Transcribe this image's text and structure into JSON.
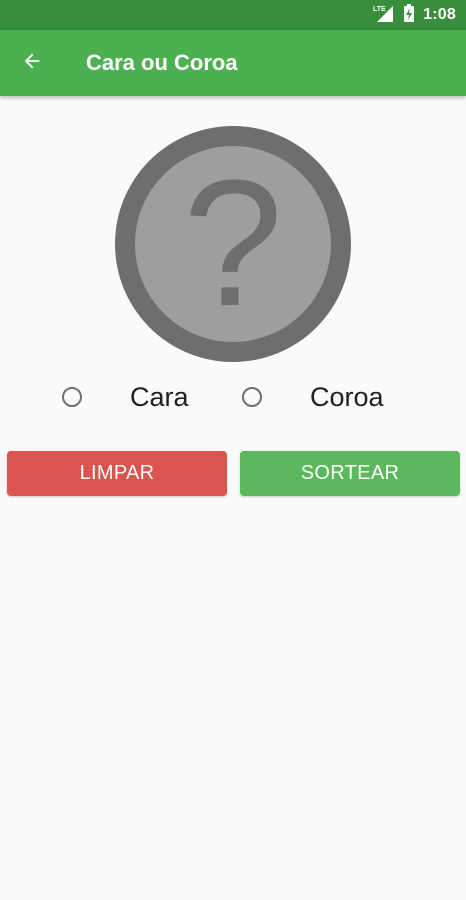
{
  "status_bar": {
    "network_icon": "lte-signal-icon",
    "battery_icon": "battery-charging-icon",
    "time": "1:08"
  },
  "app_bar": {
    "back_icon": "arrow-back-icon",
    "title": "Cara ou Coroa"
  },
  "coin": {
    "icon": "question-mark-icon",
    "symbol": "?"
  },
  "options": {
    "heads_label": "Cara",
    "tails_label": "Coroa"
  },
  "buttons": {
    "clear_label": "LIMPAR",
    "draw_label": "SORTEAR"
  },
  "colors": {
    "status_bar": "#388e3c",
    "app_bar": "#4caf50",
    "clear_button": "#d9534f",
    "draw_button": "#5cb85c",
    "coin_outer": "#6e6e6e",
    "coin_inner": "#9e9e9e"
  }
}
